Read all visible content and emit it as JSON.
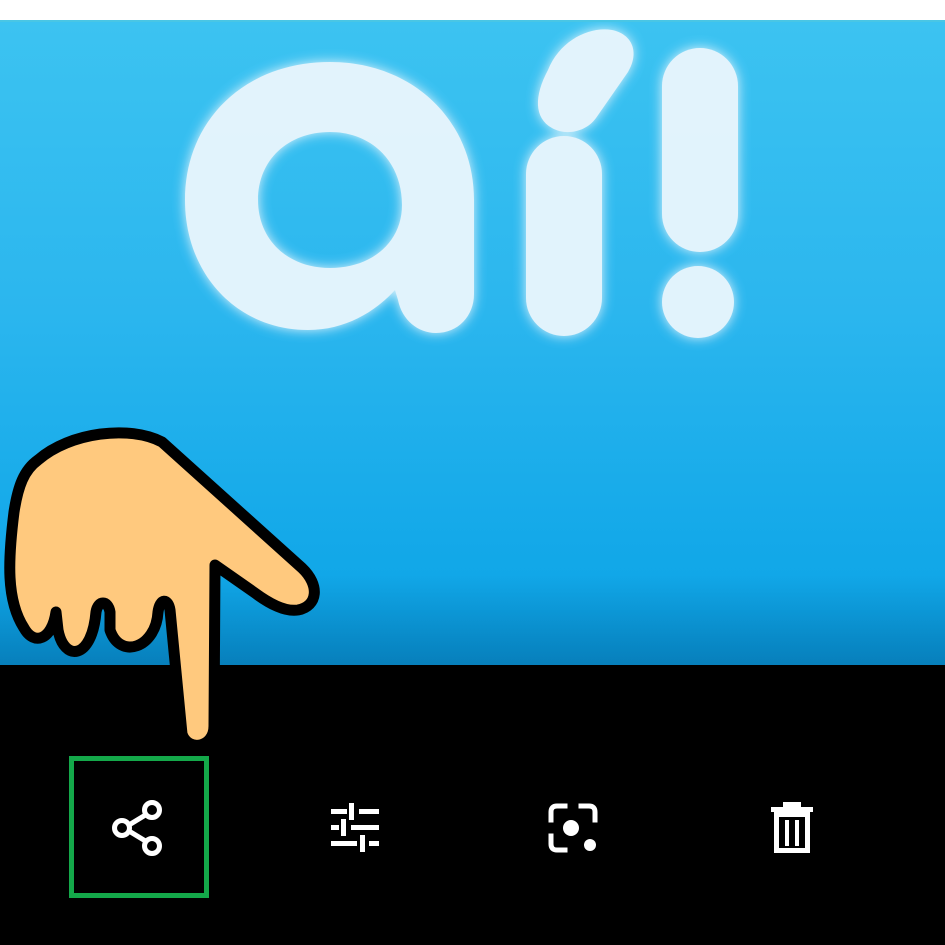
{
  "viewer": {
    "logo_text": "ai!",
    "photo_colors": {
      "top": "#3cc3f1",
      "bottom": "#0aa3e5"
    }
  },
  "toolbar": {
    "buttons": [
      {
        "id": "share",
        "icon": "share-icon",
        "highlighted": true
      },
      {
        "id": "edit",
        "icon": "sliders-icon",
        "highlighted": false
      },
      {
        "id": "lens",
        "icon": "lens-icon",
        "highlighted": false
      },
      {
        "id": "delete",
        "icon": "trash-icon",
        "highlighted": false
      }
    ],
    "highlight_color": "#14a84a"
  },
  "annotation": {
    "pointer": "pointing-hand-icon"
  }
}
